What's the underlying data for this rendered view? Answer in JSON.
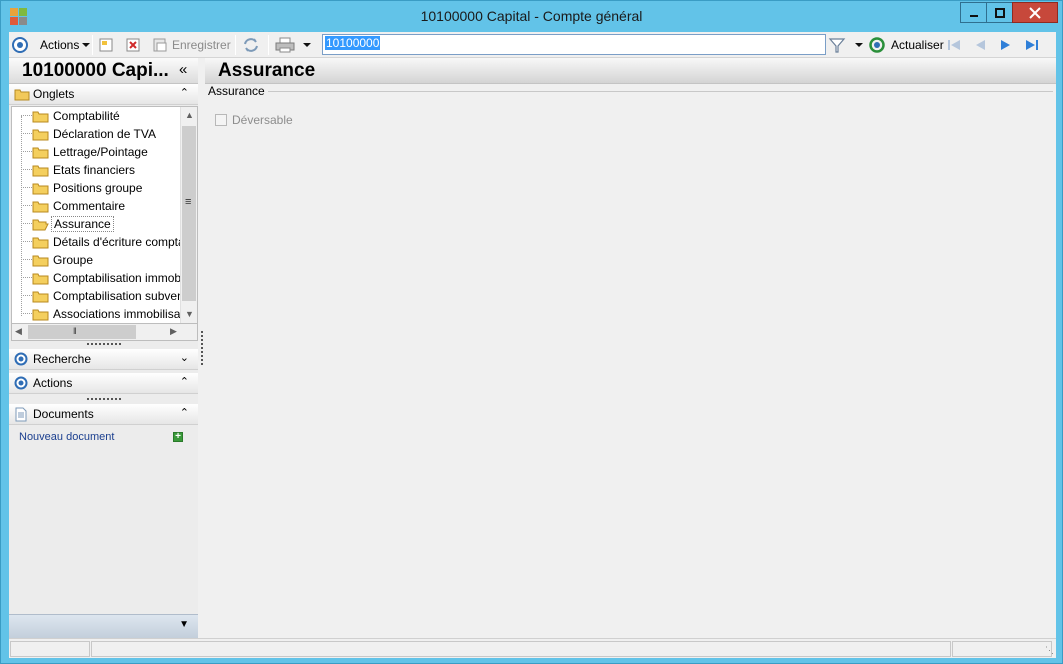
{
  "window": {
    "title": "10100000 Capital -  Compte général"
  },
  "toolbar": {
    "actions_label": "Actions",
    "save_label": "Enregistrer",
    "search_value": "10100000",
    "refresh_label": "Actualiser"
  },
  "left_pane": {
    "record_title": "10100000 Capi...",
    "collapse_glyph": "«",
    "tabs_section": {
      "title": "Onglets",
      "items": [
        {
          "label": "Comptabilité"
        },
        {
          "label": "Déclaration de TVA"
        },
        {
          "label": "Lettrage/Pointage"
        },
        {
          "label": "Etats financiers"
        },
        {
          "label": "Positions groupe"
        },
        {
          "label": "Commentaire"
        },
        {
          "label": "Assurance",
          "selected": true
        },
        {
          "label": "Détails d'écriture compta"
        },
        {
          "label": "Groupe"
        },
        {
          "label": "Comptabilisation immob"
        },
        {
          "label": "Comptabilisation subven"
        },
        {
          "label": "Associations immobilisat"
        }
      ]
    },
    "search_section": {
      "title": "Recherche"
    },
    "actions_section": {
      "title": "Actions"
    },
    "documents_section": {
      "title": "Documents",
      "new_document_label": "Nouveau document"
    }
  },
  "main": {
    "header_title": "Assurance",
    "group_title": "Assurance",
    "checkbox_label": "Déversable",
    "checkbox_checked": false
  },
  "colors": {
    "window_frame": "#62c3e8",
    "close_button": "#c7483b",
    "search_selection": "#3399ff"
  }
}
